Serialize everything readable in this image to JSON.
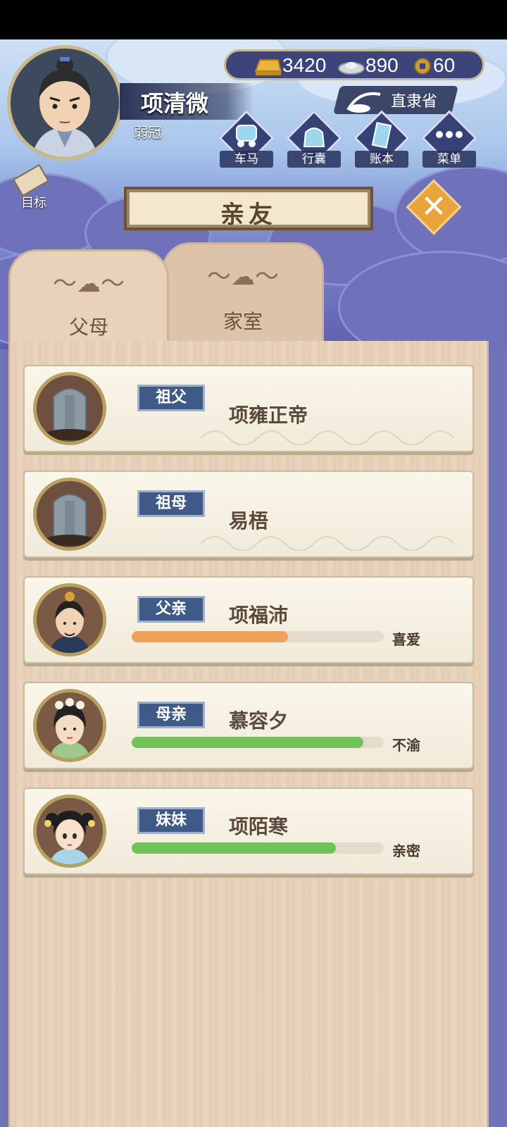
{
  "player": {
    "name": "项清微",
    "title": "弱冠"
  },
  "currency": {
    "gold": "3420",
    "silver": "890",
    "coin": "60"
  },
  "location": "直隶省",
  "menu": [
    {
      "label": "车马",
      "icon": "carriage-icon"
    },
    {
      "label": "行囊",
      "icon": "bag-icon"
    },
    {
      "label": "账本",
      "icon": "ledger-icon"
    },
    {
      "label": "菜单",
      "icon": "more-icon"
    }
  ],
  "goal_label": "目标",
  "page_title": "亲友",
  "tabs": [
    {
      "label": "父母",
      "active": true
    },
    {
      "label": "家室",
      "active": false
    }
  ],
  "family": [
    {
      "relation": "祖父",
      "name": "项雍正帝",
      "deceased": true
    },
    {
      "relation": "祖母",
      "name": "易梧",
      "deceased": true
    },
    {
      "relation": "父亲",
      "name": "项福沛",
      "affection": 0.62,
      "bar_color": "#f0a05a",
      "mood": "喜爱"
    },
    {
      "relation": "母亲",
      "name": "慕容夕",
      "affection": 0.92,
      "bar_color": "#72c25a",
      "mood": "不渝"
    },
    {
      "relation": "妹妹",
      "name": "项陌寒",
      "affection": 0.81,
      "bar_color": "#72c25a",
      "mood": "亲密"
    }
  ]
}
